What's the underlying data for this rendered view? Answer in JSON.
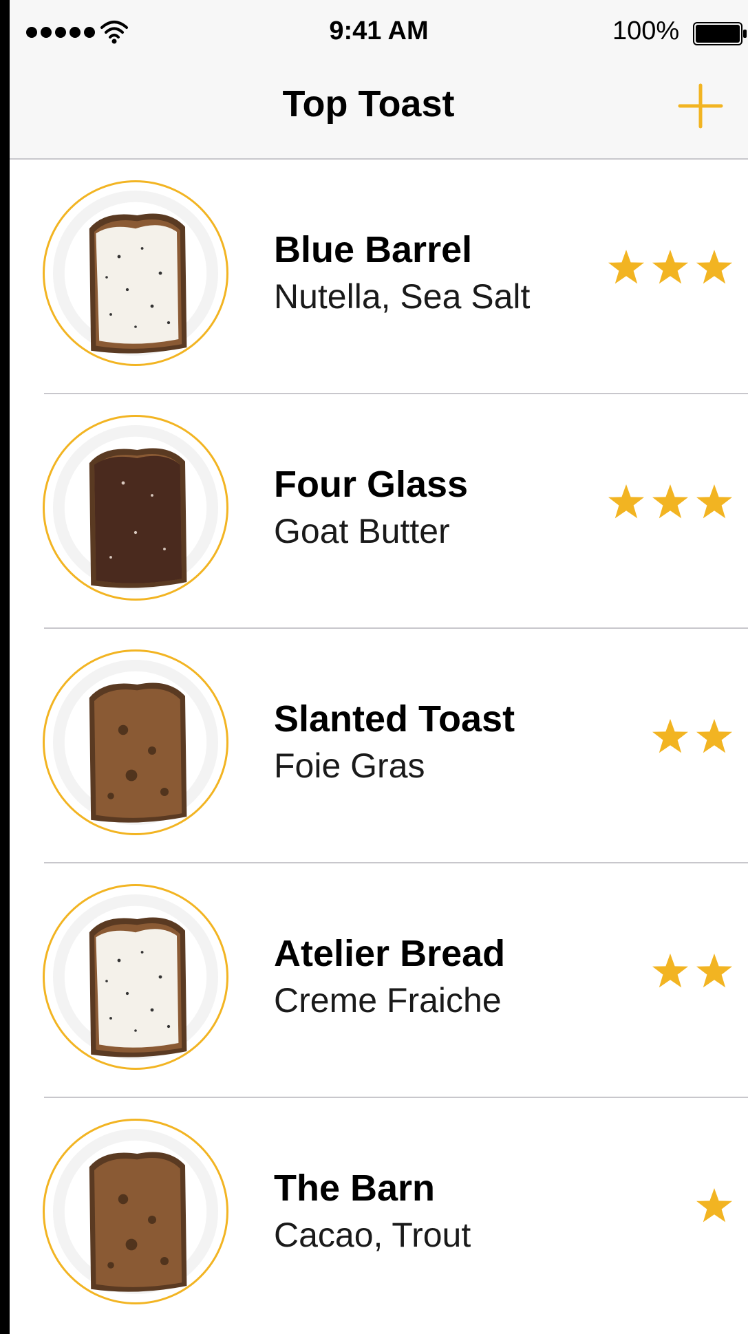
{
  "status_bar": {
    "time": "9:41 AM",
    "battery_percent": "100%",
    "signal_bars": 5,
    "icons": [
      "signal-dots-icon",
      "wifi-icon",
      "battery-icon"
    ]
  },
  "nav": {
    "title": "Top Toast",
    "add_icon": "plus-icon"
  },
  "colors": {
    "accent": "#f2b422",
    "separator": "#c8c7cc",
    "bar_background": "#f7f7f7"
  },
  "items": [
    {
      "title": "Blue Barrel",
      "subtitle": "Nutella, Sea Salt",
      "rating": 3,
      "toast": "cream"
    },
    {
      "title": "Four Glass",
      "subtitle": "Goat Butter",
      "rating": 3,
      "toast": "chocolate"
    },
    {
      "title": "Slanted Toast",
      "subtitle": "Foie Gras",
      "rating": 2,
      "toast": "plain"
    },
    {
      "title": "Atelier Bread",
      "subtitle": "Creme Fraiche",
      "rating": 2,
      "toast": "cream"
    },
    {
      "title": "The Barn",
      "subtitle": "Cacao, Trout",
      "rating": 1,
      "toast": "plain"
    }
  ]
}
